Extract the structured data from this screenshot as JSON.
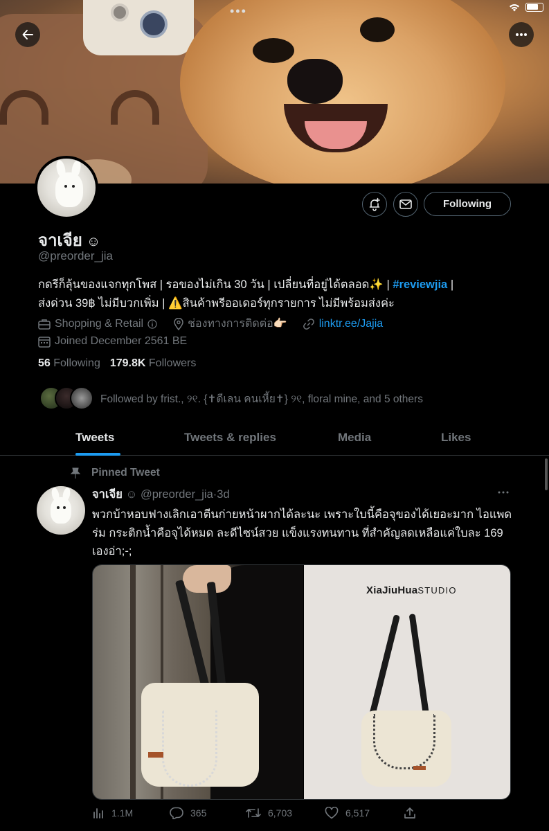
{
  "status_bar": {
    "dots": "•••"
  },
  "header": {
    "back_icon": "arrow-left-icon",
    "more_icon": "ellipsis-icon"
  },
  "profile": {
    "name": "จาเจีย",
    "name_emoji": "☺",
    "handle": "@preorder_jia",
    "following_button": "Following",
    "bio_line1_part1": "กดรีก็ลุ้นของแจกทุกโพส | รอของไม่เกิน 30 วัน | เปลี่ยนที่อยู่ได้ตลอด✨ | ",
    "bio_hashtag": "#reviewjia",
    "bio_line1_part2": " |",
    "bio_line2": "ส่งด่วน 39฿ ไม่มีบวกเพิ่ม | ⚠️สินค้าพรีออเดอร์ทุกรายการ ไม่มีพร้อมส่งค่ะ",
    "category": "Shopping & Retail",
    "contact": "ช่องทางการติดต่อ👉🏻",
    "link": "linktr.ee/Jajia",
    "joined": "Joined December 2561 BE",
    "following_count": "56",
    "following_label": "Following",
    "followers_count": "179.8K",
    "followers_label": "Followers",
    "followed_by": "Followed by frist., ୨୧. {✝ดีเลน คนเหี้ย✝} ୨୧, floral mine, and 5 others"
  },
  "tabs": [
    {
      "label": "Tweets",
      "active": true
    },
    {
      "label": "Tweets & replies",
      "active": false
    },
    {
      "label": "Media",
      "active": false
    },
    {
      "label": "Likes",
      "active": false
    }
  ],
  "tweet": {
    "pinned_label": "Pinned Tweet",
    "author_name": "จาเจีย",
    "author_emoji": "☺",
    "author_handle": "@preorder_jia",
    "dot": "·",
    "time": "3d",
    "text": "พวกบ้าหอบฟางเลิกเอาตีนก่ายหน้าผากได้ละนะ เพราะใบนี้คือจุของได้เยอะมาก ไอแพด ร่ม กระติกน้ำคือจุได้หมด ละดีไซน์สวย แข็งแรงทนทาน ที่สำคัญลดเหลือแค่ใบละ 169 เองอ่า;-;",
    "media_brand_bold": "XiaJiuHua",
    "media_brand_rest": "STUDIO",
    "views": "1.1M",
    "replies": "365",
    "retweets": "6,703",
    "likes": "6,517"
  },
  "colors": {
    "accent": "#1d9bf0",
    "background": "#000000",
    "muted": "#71767b",
    "text": "#e7e9ea"
  }
}
